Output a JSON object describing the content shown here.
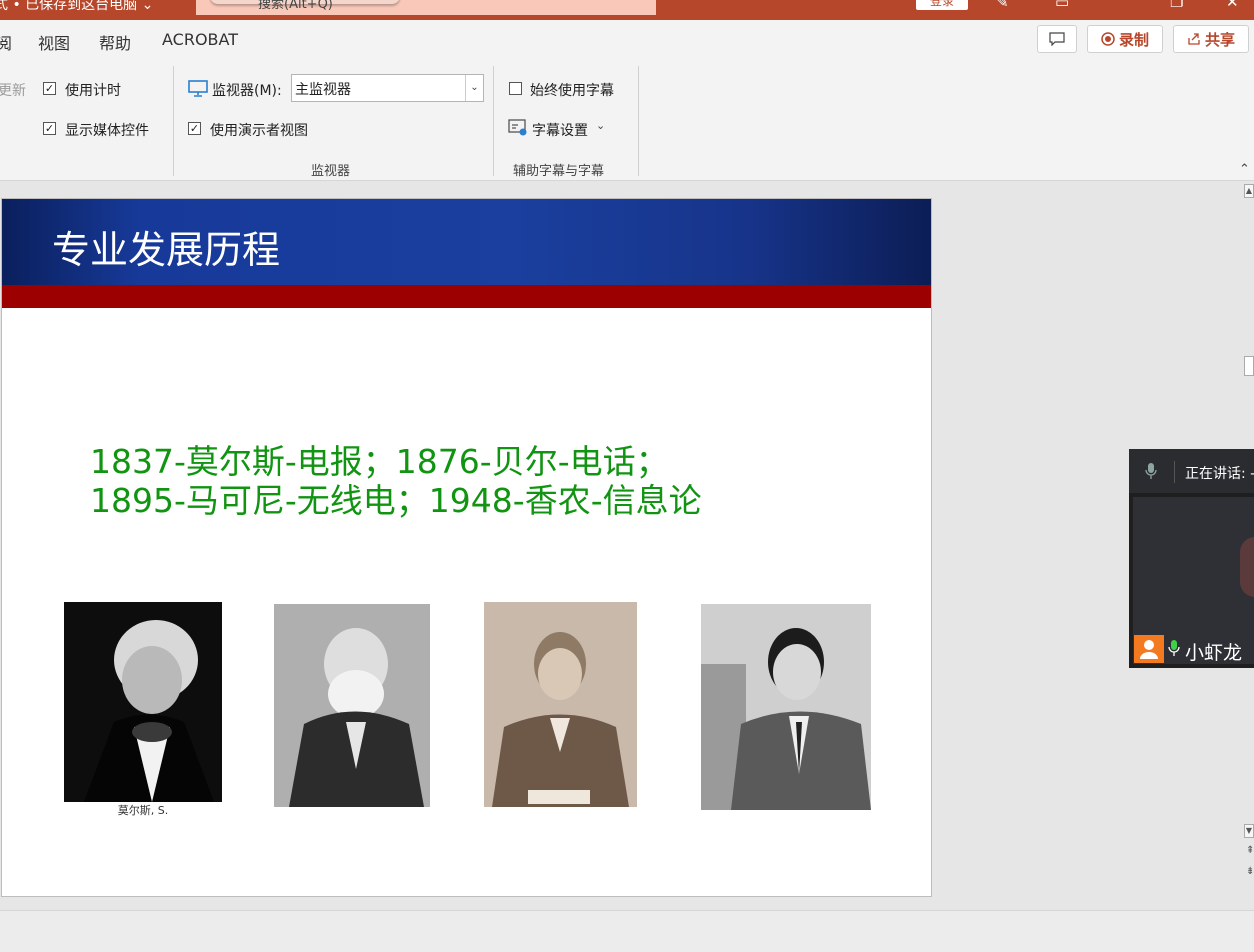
{
  "titlebar": {
    "title": "式 • 已保存到这台电脑 ⌄",
    "search_placeholder": "搜索(Alt+Q)",
    "login_label": "登录",
    "colors": {
      "accent": "#b7472a"
    }
  },
  "menubar": {
    "items": [
      "阅",
      "视图",
      "帮助",
      "ACROBAT"
    ],
    "comment_icon": "comment-icon",
    "record_label": "录制",
    "share_label": "共享"
  },
  "ribbon": {
    "update_label": "更新",
    "use_timing": {
      "label": "使用计时",
      "checked": true
    },
    "show_media_controls": {
      "label": "显示媒体控件",
      "checked": true
    },
    "monitor_label": "监视器(M):",
    "monitor_value": "主监视器",
    "presenter_view": {
      "label": "使用演示者视图",
      "checked": true
    },
    "monitor_group_label": "监视器",
    "always_subtitles": {
      "label": "始终使用字幕",
      "checked": false
    },
    "subtitle_settings_label": "字幕设置",
    "captions_group_label": "辅助字幕与字幕"
  },
  "slide": {
    "title": "专业发展历程",
    "line1": "1837-莫尔斯-电报；1876-贝尔-电话；",
    "line2": "1895-马可尼-无线电；1948-香农-信息论",
    "photo1_caption": "莫尔斯, S.",
    "text_color": "#119411",
    "header_color": "#1a3f9e",
    "redbar_color": "#9c0000"
  },
  "meeting": {
    "speaking_label": "正在讲话: -",
    "participant_name": "小虾龙"
  }
}
